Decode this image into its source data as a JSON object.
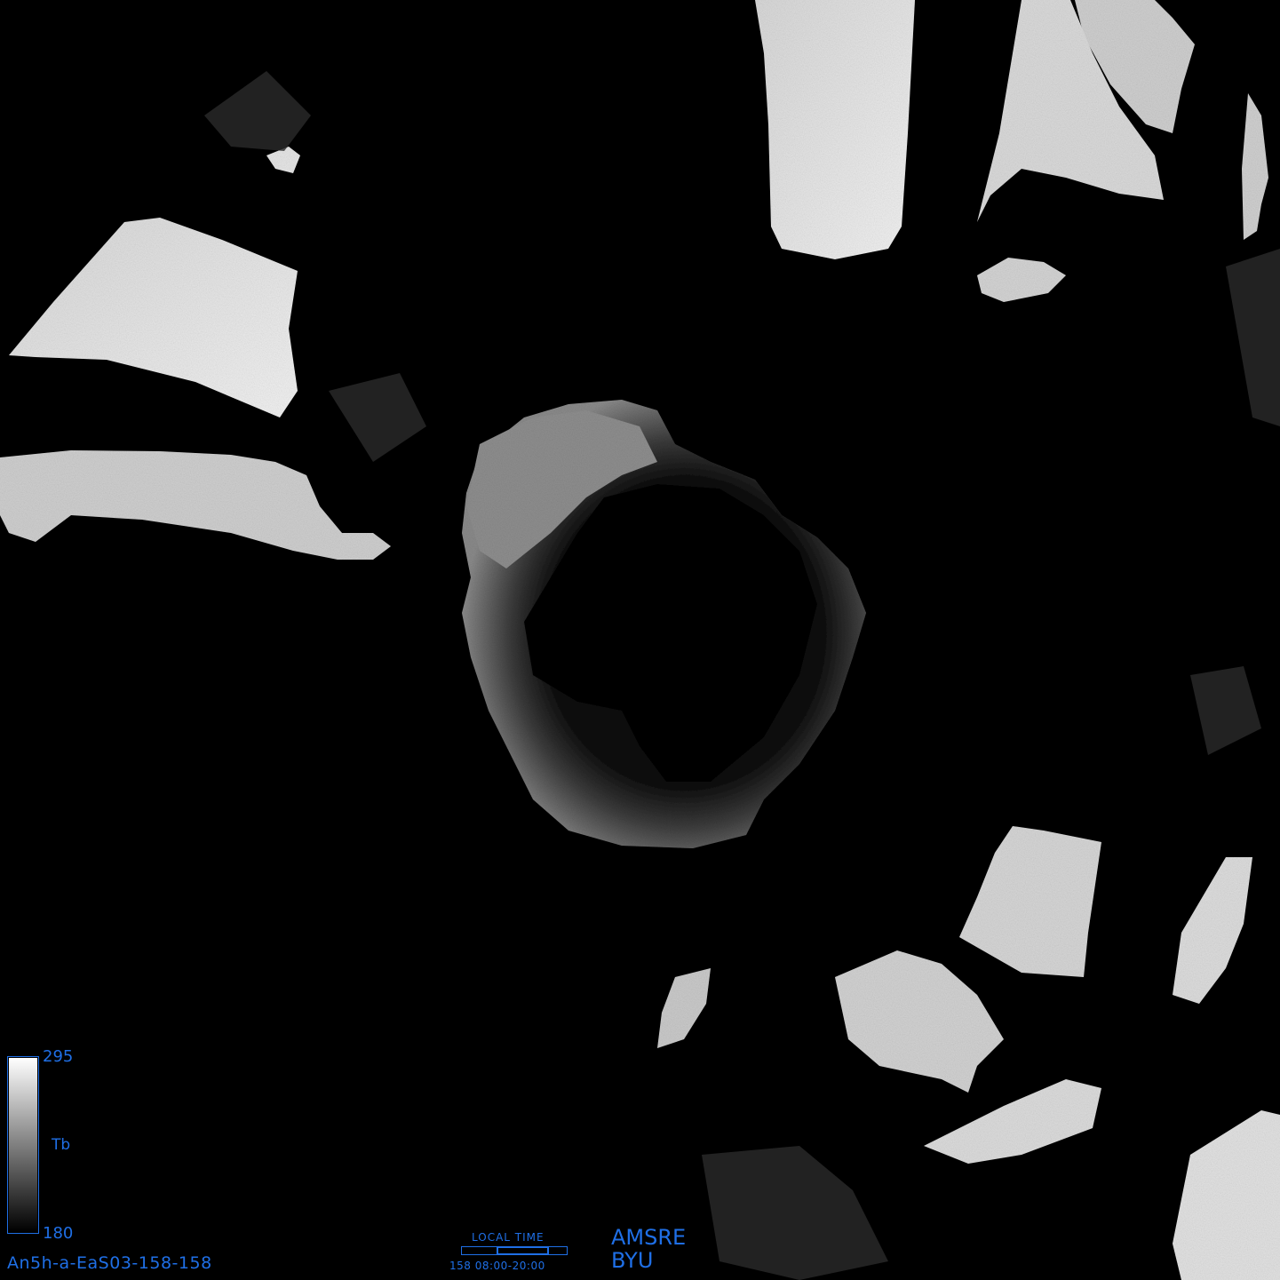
{
  "colors": {
    "background": "#000000",
    "annotation": "#1f6fe6",
    "colorbar_high": "#ffffff",
    "colorbar_low": "#000000"
  },
  "colorbar": {
    "max_label": "295",
    "min_label": "180",
    "unit_label": "Tb",
    "max_value": 295,
    "min_value": 180
  },
  "image_id": "An5h-a-EaS03-158-158",
  "local_time": {
    "label": "LOCAL TIME",
    "text": "158 08:00-20:00",
    "window_start_hour": 8,
    "window_end_hour": 20
  },
  "credits": {
    "sensor": "AMSRE",
    "organization": "BYU"
  }
}
